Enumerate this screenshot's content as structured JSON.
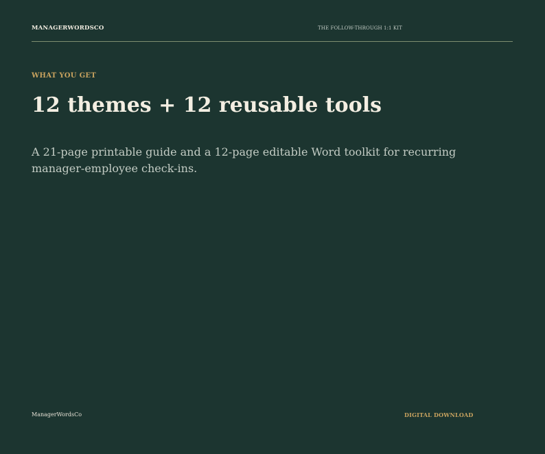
{
  "header": {
    "brand": "MANAGERWORDSCO",
    "product": "THE FOLLOW-THROUGH 1:1 KIT"
  },
  "main": {
    "eyebrow": "WHAT YOU GET",
    "headline": "12 themes + 12 reusable tools",
    "description": "A 21-page printable guide and a 12-page editable Word toolkit for recurring manager-employee check-ins."
  },
  "footer": {
    "brand": "ManagerWordsCo",
    "format": "DIGITAL DOWNLOAD"
  },
  "colors": {
    "background": "#1c3530",
    "accent": "#c9a35f",
    "text_primary": "#f3eee2",
    "text_secondary": "#c3ccc4"
  }
}
